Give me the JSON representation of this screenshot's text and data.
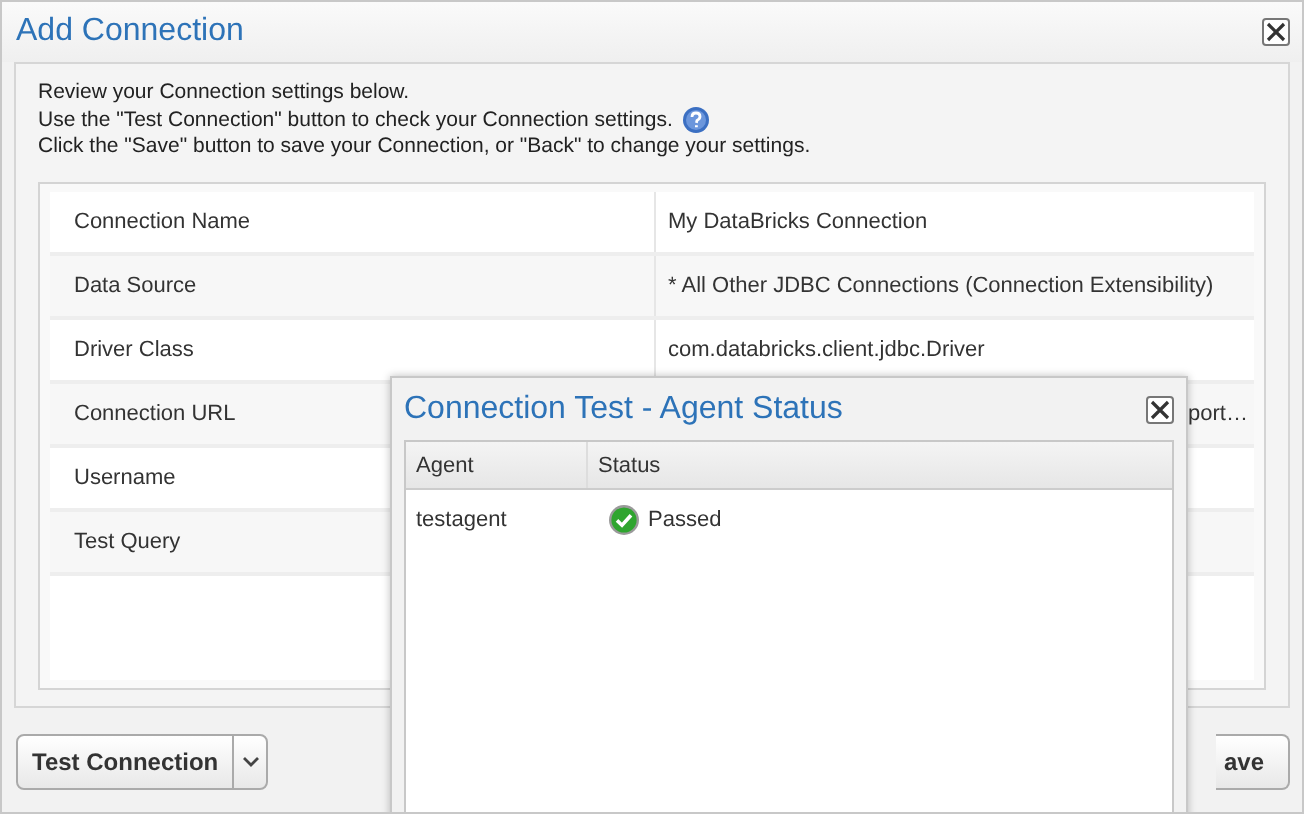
{
  "window": {
    "title": "Add Connection"
  },
  "intro": [
    "Review your Connection settings below.",
    "Use the \"Test Connection\" button to check your Connection settings.",
    "Click the \"Save\" button to save your Connection, or \"Back\" to change your settings."
  ],
  "settings": [
    {
      "label": "Connection Name",
      "value": "My DataBricks Connection"
    },
    {
      "label": "Data Source",
      "value": "* All Other JDBC Connections (Connection Extensibility)"
    },
    {
      "label": "Driver Class",
      "value": "com.databricks.client.jdbc.Driver"
    },
    {
      "label": "Connection URL",
      "value": "port…"
    },
    {
      "label": "Username"
    },
    {
      "label": "Test Query"
    }
  ],
  "buttons": {
    "test": "Test Connection",
    "save": "ave"
  },
  "dialog": {
    "title": "Connection Test - Agent Status",
    "columns": [
      "Agent",
      "Status"
    ],
    "rows": [
      {
        "agent": "testagent",
        "status": "Passed",
        "kind": "passed"
      }
    ]
  }
}
